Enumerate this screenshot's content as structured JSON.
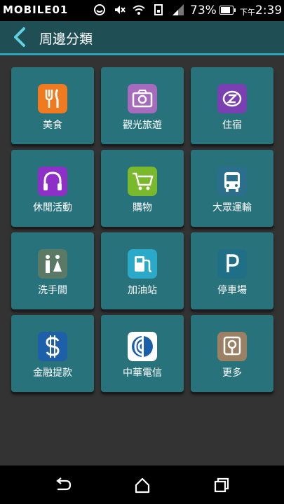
{
  "status_bar": {
    "brand": "MOBILE01",
    "battery_percent": "73%",
    "battery_level": 0.73,
    "ampm": "下午",
    "time": "2:39",
    "icons": [
      "smiley-icon",
      "mute-icon",
      "volume-off-icon",
      "wifi-icon",
      "sim-icon",
      "signal-icon",
      "battery-icon"
    ]
  },
  "header": {
    "title": "周邊分類",
    "back_icon": "back-chevron-icon",
    "bg_color": "#1f4e55",
    "accent_color": "#2ca6b8"
  },
  "categories": [
    {
      "label": "美食",
      "icon": "fork-knife-icon",
      "color": "#f07a1f"
    },
    {
      "label": "觀光旅遊",
      "icon": "camera-icon",
      "color": "#a66bbf"
    },
    {
      "label": "住宿",
      "icon": "sleep-z-icon",
      "color": "#7a3fb0"
    },
    {
      "label": "休閒活動",
      "icon": "headphones-icon",
      "color": "#8e2fc7"
    },
    {
      "label": "購物",
      "icon": "shopping-cart-icon",
      "color": "#7ab82c"
    },
    {
      "label": "大眾運輸",
      "icon": "bus-icon",
      "color": "#2b6f8c"
    },
    {
      "label": "洗手間",
      "icon": "restroom-icon",
      "color": "#5b7a66"
    },
    {
      "label": "加油站",
      "icon": "gas-pump-icon",
      "color": "#2aa9c9"
    },
    {
      "label": "停車場",
      "icon": "parking-icon",
      "color": "#1f6f86"
    },
    {
      "label": "金融提款",
      "icon": "dollar-icon",
      "color": "#1d5fa8"
    },
    {
      "label": "中華電信",
      "icon": "chunghwa-telecom-logo-icon",
      "color": "#ffffff"
    },
    {
      "label": "更多",
      "icon": "map-pin-icon",
      "color": "#9c8063"
    }
  ],
  "nav_bar": {
    "buttons": [
      "back-icon",
      "home-icon",
      "recents-icon"
    ]
  }
}
